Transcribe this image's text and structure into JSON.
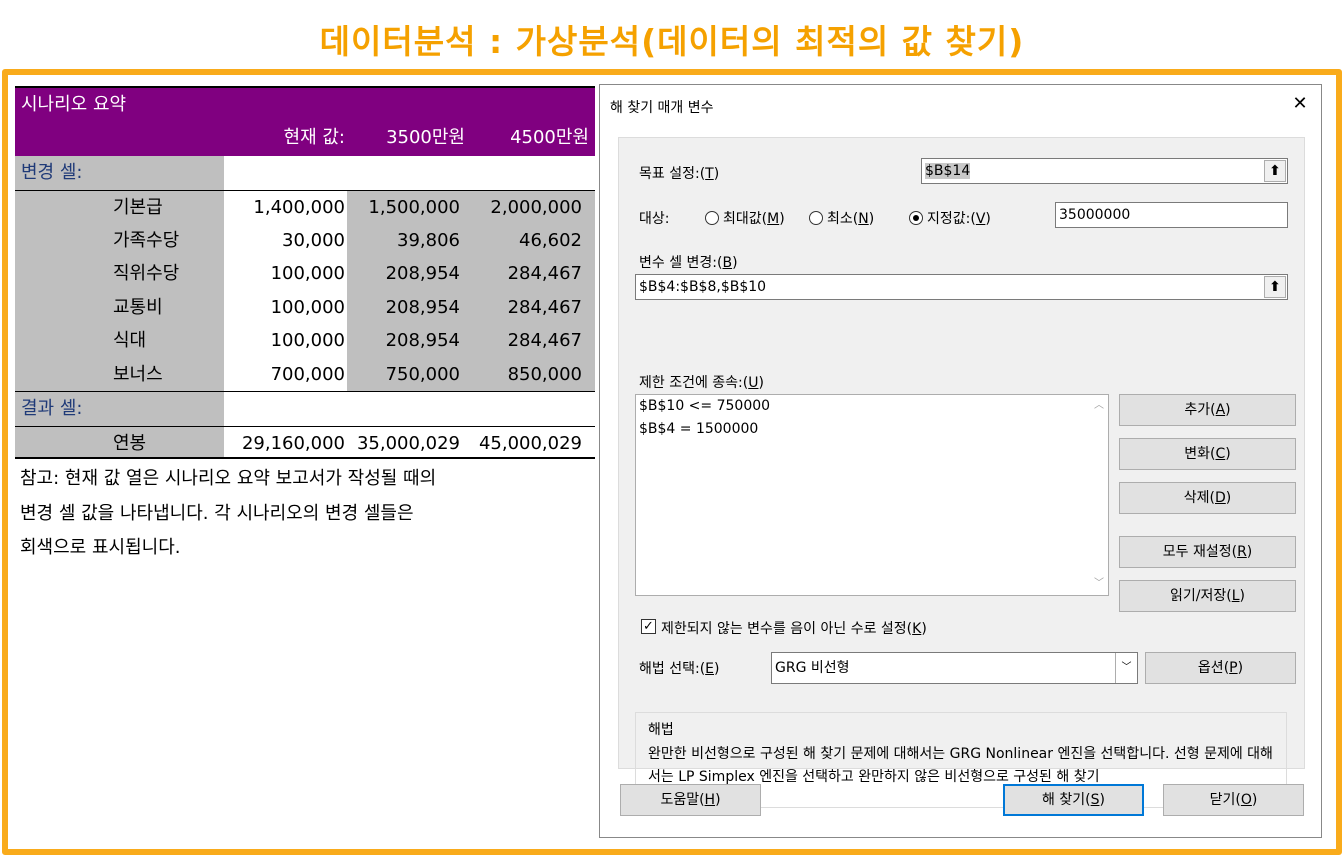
{
  "page_title": "데이터분석 : 가상분석(데이터의 최적의 값 찾기)",
  "scenario": {
    "header_title": "시나리오 요약",
    "columns": [
      "현재 값:",
      "3500만원",
      "4500만원"
    ],
    "changing_label": "변경 셀:",
    "rows": [
      {
        "name": "기본급",
        "values": [
          "1,400,000",
          "1,500,000",
          "2,000,000"
        ]
      },
      {
        "name": "가족수당",
        "values": [
          "30,000",
          "39,806",
          "46,602"
        ]
      },
      {
        "name": "직위수당",
        "values": [
          "100,000",
          "208,954",
          "284,467"
        ]
      },
      {
        "name": "교통비",
        "values": [
          "100,000",
          "208,954",
          "284,467"
        ]
      },
      {
        "name": "식대",
        "values": [
          "100,000",
          "208,954",
          "284,467"
        ]
      },
      {
        "name": "보너스",
        "values": [
          "700,000",
          "750,000",
          "850,000"
        ]
      }
    ],
    "result_label": "결과 셀:",
    "result_row": {
      "name": "연봉",
      "values": [
        "29,160,000",
        "35,000,029",
        "45,000,029"
      ]
    },
    "note_lines": [
      "참고: 현재 값 열은 시나리오 요약 보고서가 작성될 때의",
      "변경 셀 값을 나타냅니다. 각 시나리오의 변경 셀들은",
      "회색으로 표시됩니다."
    ]
  },
  "dialog": {
    "title": "해 찾기 매개 변수",
    "close": "✕",
    "objective_label": "목표 설정:",
    "objective_key": "T",
    "objective_value": "$B$14",
    "target_label": "대상:",
    "radio_max": "최대값",
    "radio_max_key": "M",
    "radio_min": "최소",
    "radio_min_key": "N",
    "radio_value": "지정값:",
    "radio_value_key": "V",
    "target_value": "35000000",
    "variable_label": "변수 셀 변경:",
    "variable_key": "B",
    "variable_value": "$B$4:$B$8,$B$10",
    "constraints_label": "제한 조건에 종속:",
    "constraints_key": "U",
    "constraints": [
      "$B$10 <= 750000",
      "$B$4 = 1500000"
    ],
    "btn_add": "추가",
    "btn_add_key": "A",
    "btn_change": "변화",
    "btn_change_key": "C",
    "btn_delete": "삭제",
    "btn_delete_key": "D",
    "btn_reset": "모두 재설정",
    "btn_reset_key": "R",
    "btn_load": "읽기/저장",
    "btn_load_key": "L",
    "nonneg_label": "제한되지 않는 변수를 음이 아닌 수로 설정",
    "nonneg_key": "K",
    "nonneg_checked": "☑",
    "method_label": "해법 선택:",
    "method_key": "E",
    "method_value": "GRG 비선형",
    "btn_options": "옵션",
    "btn_options_key": "P",
    "method_box_title": "해법",
    "method_box_desc": "완만한 비선형으로 구성된 해 찾기 문제에 대해서는 GRG Nonlinear 엔진을 선택합니다. 선형 문제에 대해서는 LP Simplex 엔진을 선택하고 완만하지 않은 비선형으로 구성된 해 찾기",
    "btn_help": "도움말",
    "btn_help_key": "H",
    "btn_solve": "해 찾기",
    "btn_solve_key": "S",
    "btn_close": "닫기",
    "btn_close_key": "O"
  }
}
